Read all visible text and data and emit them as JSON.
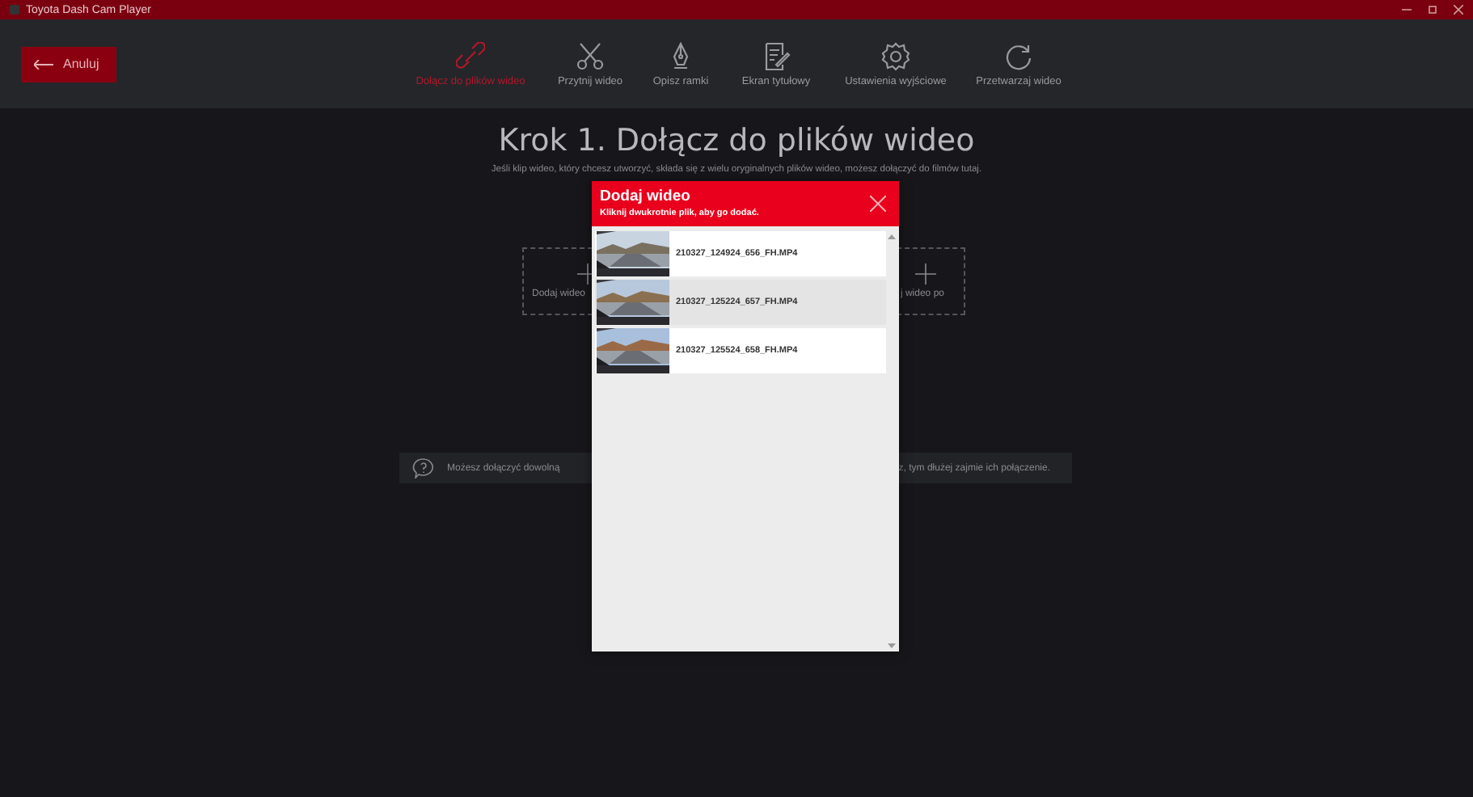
{
  "window": {
    "title": "Toyota Dash Cam Player"
  },
  "toolbar": {
    "cancel_button": "Anuluj",
    "steps": [
      {
        "label": "Dołącz do plików wideo",
        "kind": "link",
        "selected": true
      },
      {
        "label": "Przytnij wideo",
        "kind": "scissors",
        "selected": false
      },
      {
        "label": "Opisz ramki",
        "kind": "pen",
        "selected": false
      },
      {
        "label": "Ekran tytułowy",
        "kind": "note",
        "selected": false
      },
      {
        "label": "Ustawienia wyjściowe",
        "kind": "gear",
        "selected": false
      },
      {
        "label": "Przetwarzaj wideo",
        "kind": "refresh",
        "selected": false
      }
    ]
  },
  "step": {
    "heading": "Krok 1. Dołącz do plików wideo",
    "description": "Jeśli klip wideo, który chcesz utworzyć, składa się z wielu oryginalnych plików wideo, możesz dołączyć do filmów tutaj."
  },
  "add_before": {
    "label": "Dodaj wideo"
  },
  "add_after": {
    "label": "j wideo po"
  },
  "hint": {
    "text_left": "Możesz dołączyć dowolną",
    "text_right": "z, tym dłużej zajmie ich połączenie."
  },
  "dialog": {
    "title": "Dodaj wideo",
    "subtitle": "Kliknij dwukrotnie plik, aby go dodać.",
    "files": [
      {
        "name": "210327_124924_656_FH.MP4",
        "selected": false
      },
      {
        "name": "210327_125224_657_FH.MP4",
        "selected": true
      },
      {
        "name": "210327_125524_658_FH.MP4",
        "selected": false
      }
    ]
  }
}
